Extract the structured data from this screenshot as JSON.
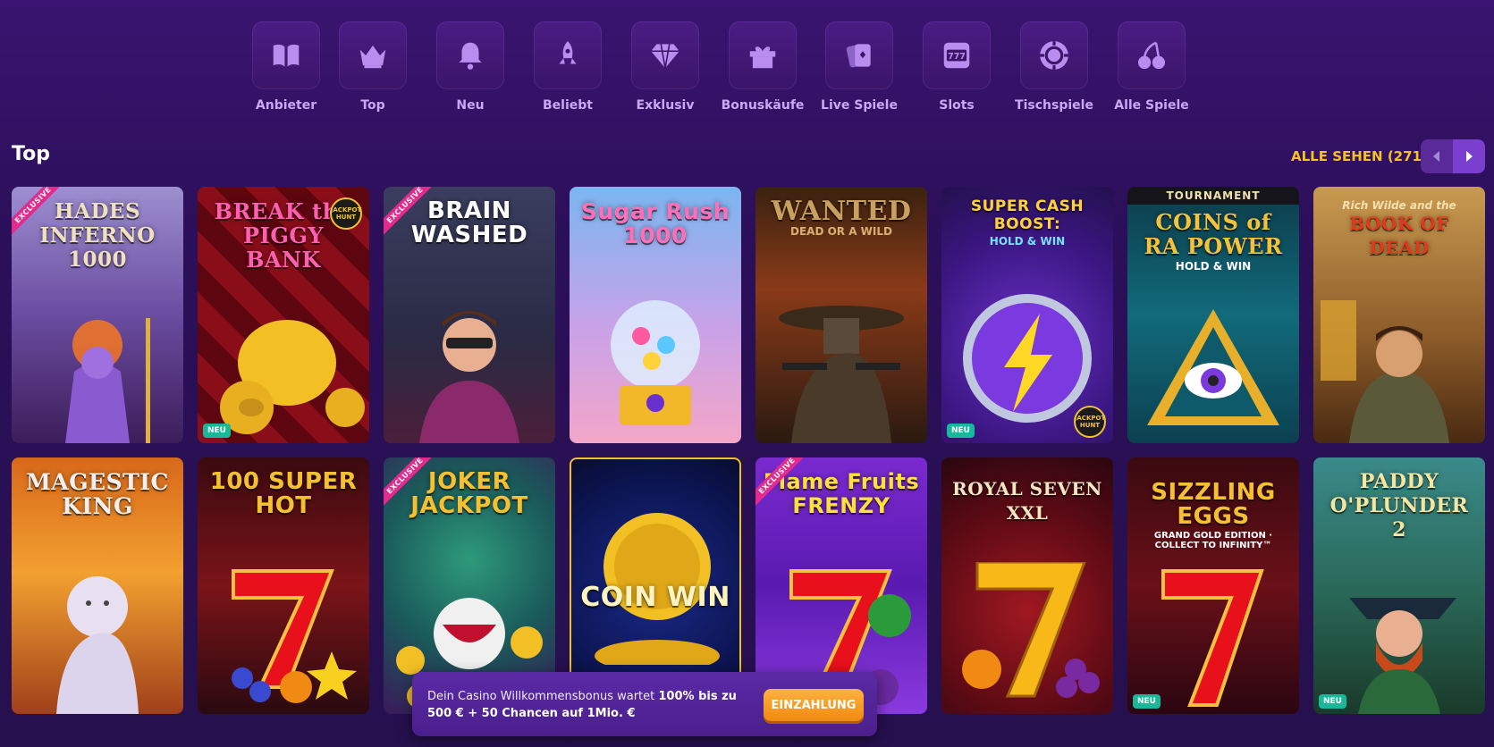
{
  "categories": [
    {
      "label": "Anbieter",
      "icon": "book-icon"
    },
    {
      "label": "Top",
      "icon": "crown-icon"
    },
    {
      "label": "Neu",
      "icon": "bell-icon"
    },
    {
      "label": "Beliebt",
      "icon": "rocket-icon"
    },
    {
      "label": "Exklusiv",
      "icon": "diamond-icon"
    },
    {
      "label": "Bonuskäufe",
      "icon": "gift-icon"
    },
    {
      "label": "Live Spiele",
      "icon": "cards-icon"
    },
    {
      "label": "Slots",
      "icon": "slot-machine-icon"
    },
    {
      "label": "Tischspiele",
      "icon": "poker-chip-icon"
    },
    {
      "label": "Alle Spiele",
      "icon": "cherries-icon"
    }
  ],
  "section": {
    "title": "Top",
    "see_all": "ALLE SEHEN (271)"
  },
  "games": [
    {
      "title": "HADES INFERNO 1000",
      "ribbon": "EXCLUSIVE",
      "badge": "",
      "sub": ""
    },
    {
      "title": "BREAK the PIGGY BANK",
      "ribbon": "",
      "badge": "NEU",
      "sub": "",
      "jackpot": "JACKPOT HUNT"
    },
    {
      "title": "BRAIN WASHED",
      "ribbon": "EXCLUSIVE",
      "badge": "",
      "sub": ""
    },
    {
      "title": "Sugar Rush 1000",
      "ribbon": "",
      "badge": "",
      "sub": ""
    },
    {
      "title": "WANTED",
      "ribbon": "",
      "badge": "",
      "sub": "DEAD OR A WILD"
    },
    {
      "title": "SUPER CASH BOOST:",
      "ribbon": "",
      "badge": "NEU",
      "sub": "HOLD & WIN",
      "jackpot": "JACKPOT HUNT"
    },
    {
      "title": "COINS of RA POWER",
      "ribbon": "",
      "badge": "",
      "sub": "HOLD & WIN",
      "tournament": "TOURNAMENT"
    },
    {
      "title": "BOOK OF DEAD",
      "ribbon": "",
      "badge": "",
      "sub": "Rich Wilde and the"
    },
    {
      "title": "MAGESTIC KING",
      "ribbon": "",
      "badge": "",
      "sub": ""
    },
    {
      "title": "100 SUPER HOT",
      "ribbon": "",
      "badge": "",
      "sub": ""
    },
    {
      "title": "JOKER JACKPOT",
      "ribbon": "EXCLUSIVE",
      "badge": "",
      "sub": ""
    },
    {
      "title": "COIN WIN",
      "ribbon": "",
      "badge": "",
      "sub": ""
    },
    {
      "title": "Flame Fruits FRENZY",
      "ribbon": "EXCLUSIVE",
      "badge": "",
      "sub": ""
    },
    {
      "title": "ROYAL SEVEN XXL",
      "ribbon": "",
      "badge": "",
      "sub": ""
    },
    {
      "title": "SIZZLING EGGS",
      "ribbon": "",
      "badge": "NEU",
      "sub": "GRAND GOLD EDITION · COLLECT TO INFINITY™"
    },
    {
      "title": "PADDY O'PLUNDER 2",
      "ribbon": "",
      "badge": "NEU",
      "sub": ""
    }
  ],
  "promo": {
    "text_plain": "Dein Casino Willkommensbonus wartet ",
    "text_bold": "100% bis zu 500 € + 50 Chancen auf 1Mio. €",
    "button": "EINZAHLUNG"
  },
  "colors": {
    "accent_gold": "#f7c221",
    "category_label": "#c8a9f4",
    "badge_new": "#19b89a",
    "ribbon_exclusive": "#e32a8d",
    "button_orange": "#f08a12"
  }
}
